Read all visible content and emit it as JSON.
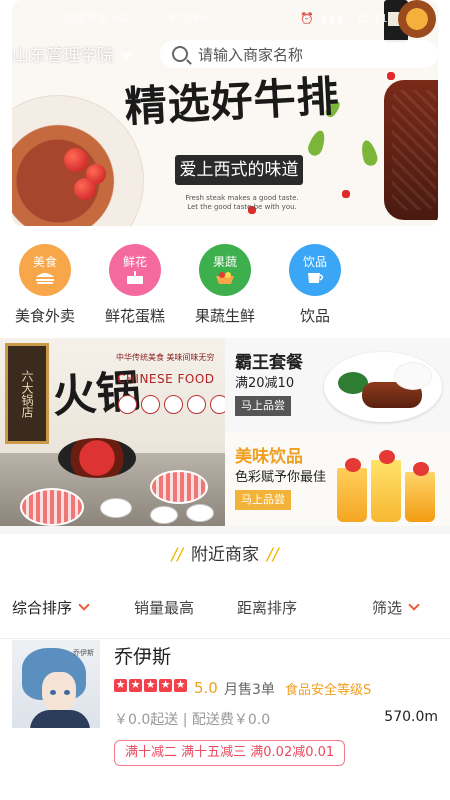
{
  "status_bar": {
    "carrier": "中国电信 4G",
    "speed": "97.0K/s",
    "icons": "⏰ ▮▮▮",
    "time": "15:11"
  },
  "top": {
    "location": "山东管理学院",
    "search_placeholder": "请输入商家名称"
  },
  "banner": {
    "title": "精选好牛排",
    "subtitle": "爱上西式的味道",
    "english": "Fresh steak makes a good taste. Let the good taste be with you."
  },
  "categories": [
    {
      "icon_text": "美食",
      "label": "美食外卖",
      "color": "#f7a64a",
      "icon": "burger-icon"
    },
    {
      "icon_text": "鲜花",
      "label": "鲜花蛋糕",
      "color": "#f56a9e",
      "icon": "cake-icon"
    },
    {
      "icon_text": "果蔬",
      "label": "果蔬生鲜",
      "color": "#3db04d",
      "icon": "vegetable-basket-icon"
    },
    {
      "icon_text": "饮品",
      "label": "饮品",
      "color": "#3aa6f5",
      "icon": "cup-icon"
    }
  ],
  "promos": {
    "left": {
      "sign": "六大锅店",
      "title": "火锅",
      "cn_line": "中华传统美食  美味间味无穷",
      "en_title": "CHINESE FOOD"
    },
    "right_top": {
      "title": "霸王套餐",
      "desc": "满20减10",
      "button": "马上品尝"
    },
    "right_bottom": {
      "title": "美味饮品",
      "desc": "色彩赋予你最佳",
      "button": "马上品尝"
    }
  },
  "nearby": {
    "title": "附近商家",
    "deco": "//"
  },
  "sort_options": [
    "综合排序",
    "销量最高",
    "距离排序",
    "筛选"
  ],
  "merchant": {
    "name": "乔伊斯",
    "image_tag": "乔伊斯",
    "rating": "5.0",
    "stars": 5,
    "monthly_sales": "月售3单",
    "safety_level": "食品安全等级S",
    "delivery": "￥0.0起送 | 配送费￥0.0",
    "distance": "570.0m",
    "promotion": "满十减二 满十五减三 满0.02减0.01"
  },
  "colors": {
    "accent_orange": "#f0a020",
    "sort_chevron": "#f05a3a",
    "star_red": "#f2414b",
    "promo_pink": "#ea4a5f"
  }
}
